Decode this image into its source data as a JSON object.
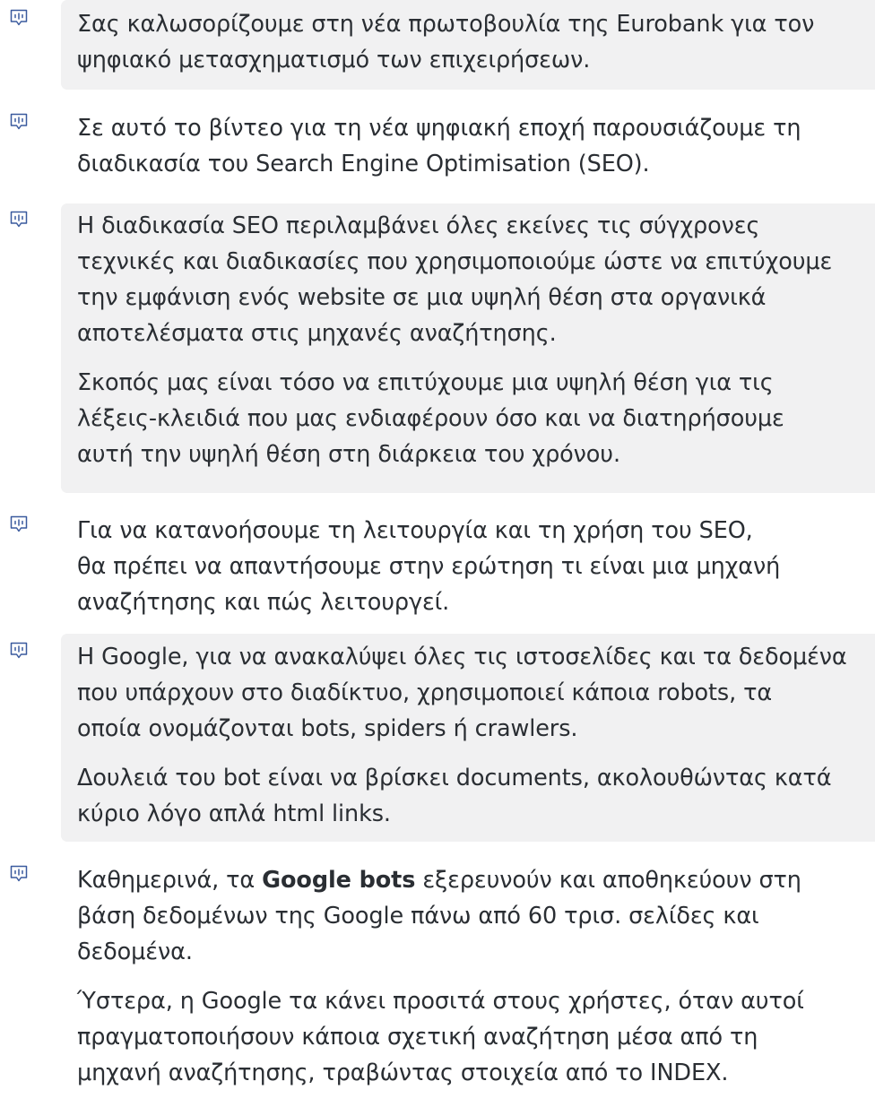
{
  "colors": {
    "block_background": "#f1f1f2",
    "icon_stroke": "#3a5a9e",
    "text": "#2a2e33"
  },
  "icon_name": "transcript-bubble-icon",
  "transcript": [
    {
      "highlighted": true,
      "paragraphs": [
        {
          "lines": [
            "Σας καλωσορίζουμε στη νέα πρωτοβουλία της Eurobank για τον",
            "ψηφιακό μετασχηματισμό των επιχειρήσεων."
          ]
        }
      ]
    },
    {
      "highlighted": false,
      "paragraphs": [
        {
          "lines": [
            "Σε αυτό το βίντεο για τη νέα ψηφιακή εποχή παρουσιάζουμε τη",
            "διαδικασία του Search Engine Optimisation (SEO)."
          ]
        }
      ]
    },
    {
      "highlighted": true,
      "paragraphs": [
        {
          "lines": [
            "Η διαδικασία SEO περιλαμβάνει όλες εκείνες τις σύγχρονες",
            "τεχνικές και διαδικασίες που χρησιμοποιούμε ώστε να επιτύχουμε",
            "την εμφάνιση ενός website σε μια υψηλή θέση στα οργανικά",
            "αποτελέσματα στις μηχανές αναζήτησης."
          ]
        },
        {
          "lines": [
            "Σκοπός μας είναι τόσο να επιτύχουμε μια υψηλή θέση για τις",
            "λέξεις-κλειδιά που μας ενδιαφέρουν όσο και να διατηρήσουμε",
            "αυτή την υψηλή θέση στη διάρκεια του χρόνου."
          ]
        }
      ]
    },
    {
      "highlighted": false,
      "paragraphs": [
        {
          "lines": [
            "Για να κατανοήσουμε τη λειτουργία και τη χρήση του SEO,",
            "θα πρέπει να απαντήσουμε στην ερώτηση τι είναι μια μηχανή",
            "αναζήτησης και πώς λειτουργεί."
          ]
        }
      ]
    },
    {
      "highlighted": true,
      "paragraphs": [
        {
          "lines": [
            "Η Google, για να ανακαλύψει όλες τις ιστοσελίδες και τα δεδομένα",
            "που υπάρχουν στο διαδίκτυο, χρησιμοποιεί κάποια robots, τα",
            "οποία ονομάζονται bots, spiders ή crawlers."
          ]
        },
        {
          "lines": [
            "Δουλειά του bot είναι να βρίσκει documents, ακολουθώντας κατά",
            "κύριο λόγο απλά html links."
          ]
        }
      ]
    },
    {
      "highlighted": false,
      "paragraphs": [
        {
          "lines": [
            [
              {
                "text": "Καθημερινά, τα "
              },
              {
                "text": "Google bots",
                "bold": true
              },
              {
                "text": " εξερευνούν και αποθηκεύουν στη"
              }
            ],
            "βάση δεδομένων της Google πάνω από 60 τρισ. σελίδες και",
            "δεδομένα."
          ]
        },
        {
          "lines": [
            "Ύστερα, η Google τα κάνει προσιτά στους χρήστες, όταν αυτοί",
            "πραγματοποιήσουν κάποια σχετική αναζήτηση μέσα από τη",
            "μηχανή αναζήτησης, τραβώντας στοιχεία από το INDEX."
          ]
        }
      ]
    }
  ]
}
